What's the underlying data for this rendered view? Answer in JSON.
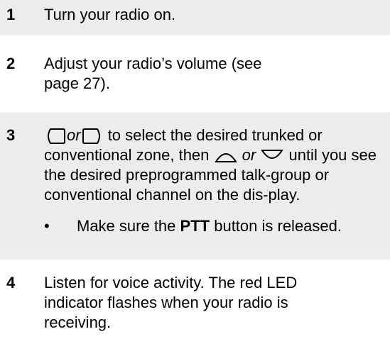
{
  "steps": [
    {
      "number": "1",
      "text": "Turn your radio on."
    },
    {
      "number": "2",
      "text": "Adjust your radio’s volume (see page 27)."
    },
    {
      "number": "3",
      "or_1": "or",
      "text_1": "to select the desired trunked or conventional zone, then",
      "or_2": "or",
      "text_2": "until you see the desired preprogrammed talk-group or conventional channel on the dis-play.",
      "bullet": {
        "symbol": "•",
        "text_before": "Make sure the",
        "bold": "PTT",
        "text_after": "button is released."
      },
      "icons": [
        "left-arrow-button-icon",
        "right-arrow-button-icon",
        "up-arrow-button-icon",
        "down-arrow-button-icon"
      ]
    },
    {
      "number": "4",
      "text": "Listen for voice activity. The red LED indicator flashes when your radio is receiving."
    }
  ],
  "colors": {
    "shade": "#ececec",
    "text": "#000000"
  }
}
